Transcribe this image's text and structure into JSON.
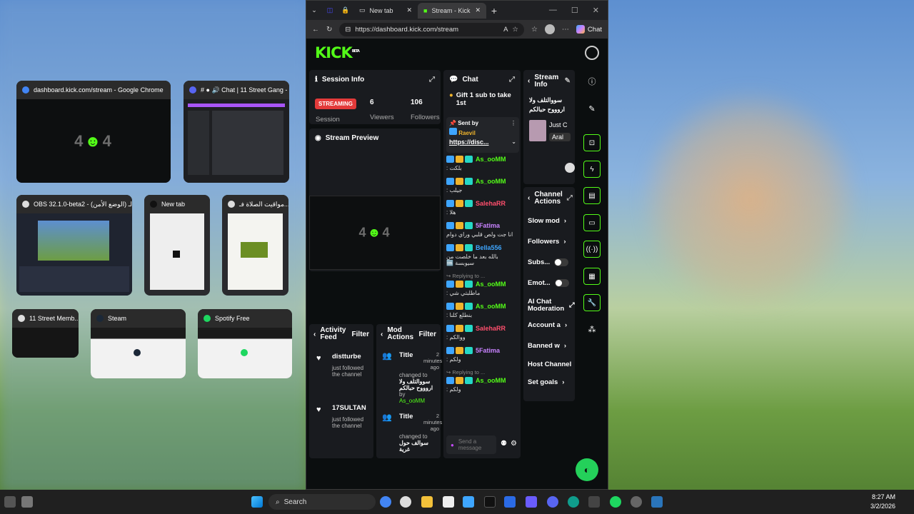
{
  "task_view": {
    "windows": [
      {
        "title": "dashboard.kick.com/stream - Google Chrome"
      },
      {
        "title": "# ● 🔊 Chat | 11 Street Gang - D..."
      },
      {
        "title": "OBS 32.1.0-beta2 - الـ (الوضع الأمن)"
      },
      {
        "title": "New tab"
      },
      {
        "title": "مواقيت الصلاة فـ..."
      },
      {
        "title": "11 Street Memb..."
      },
      {
        "title": "Steam"
      },
      {
        "title": "Spotify Free"
      }
    ],
    "error_text": "404"
  },
  "browser": {
    "tabs": [
      {
        "label": "New tab"
      },
      {
        "label": "Stream - Kick"
      }
    ],
    "url": "https://dashboard.kick.com/stream",
    "chat_button": "Chat"
  },
  "kick": {
    "logo": "KICK",
    "logo_sup": "BETA",
    "session": {
      "title": "Session Info",
      "status": "STREAMING",
      "status_label": "Session",
      "viewers_value": "6",
      "viewers_label": "Viewers",
      "followers_value": "106",
      "followers_label": "Followers"
    },
    "preview": {
      "title": "Stream Preview",
      "error_text": "404"
    },
    "chat": {
      "title": "Chat",
      "pinned": "Gift 1 sub to take 1st",
      "sent_by_label": "Sent by",
      "sent_by_user": "Raevil",
      "link": "https://disc...",
      "messages": [
        {
          "user": "As_ooMM",
          "color": "#53fc18",
          "text": "بلكت :",
          "reply": ""
        },
        {
          "user": "As_ooMM",
          "color": "#53fc18",
          "text": "جيلب :",
          "reply": ""
        },
        {
          "user": "SalehaRR",
          "color": "#ff4f6d",
          "text": "هلا :",
          "reply": ""
        },
        {
          "user": "5Fatima",
          "color": "#c882ff",
          "text": "انا جت ولص قلبي وراي دوام",
          "reply": ""
        },
        {
          "user": "Bella556",
          "color": "#3ea6ff",
          "text": "بالله بعد ما خلصت من سيوبسة 🆒",
          "reply": ""
        },
        {
          "user": "As_ooMM",
          "color": "#53fc18",
          "text": "ماطلبتي شي :",
          "reply": "Replying to ..."
        },
        {
          "user": "As_ooMM",
          "color": "#53fc18",
          "text": "بنطلع كلنا :",
          "reply": ""
        },
        {
          "user": "SalehaRR",
          "color": "#ff4f6d",
          "text": "ووالكم :",
          "reply": ""
        },
        {
          "user": "5Fatima",
          "color": "#c882ff",
          "text": "ولكم :",
          "reply": ""
        },
        {
          "user": "As_ooMM",
          "color": "#53fc18",
          "text": "ولكم :",
          "reply": "Replying to ..."
        }
      ],
      "input_placeholder": "Send a message"
    },
    "stream_info": {
      "title": "Stream Info",
      "stream_title": "سووالتلف ولا اروووح حبالكم",
      "category_line1": "Just C",
      "category_line2": "Aral"
    },
    "channel_actions": {
      "title": "Channel Actions",
      "items": [
        {
          "label": "Slow mod"
        },
        {
          "label": "Followers"
        },
        {
          "label": "Subs..."
        },
        {
          "label": "Emot..."
        },
        {
          "label": "AI Chat Moderation"
        },
        {
          "label": "Account a"
        },
        {
          "label": "Banned w"
        },
        {
          "label": "Host Channel"
        },
        {
          "label": "Set goals"
        }
      ]
    },
    "activity_feed": {
      "title": "Activity Feed",
      "filter": "Filter",
      "items": [
        {
          "name": "distturbe",
          "text": "just followed the channel"
        },
        {
          "name": "17SULTAN",
          "text": "just followed the channel"
        }
      ]
    },
    "mod_actions": {
      "title": "Mod Actions",
      "filter": "Filter",
      "items": [
        {
          "label": "Title",
          "time": "2 minutes ago",
          "text": "changed to",
          "value": "سووالتلف ولا اروووح حبالكم",
          "by": "by",
          "user": "As_ooMM"
        },
        {
          "label": "Title",
          "time": "2 minutes ago",
          "text": "changed to",
          "value": "سوالف حول غرية",
          "by": "",
          "user": ""
        }
      ]
    }
  },
  "taskbar": {
    "search": "Search",
    "time": "8:27 AM",
    "date": "3/2/2026"
  },
  "colors": {
    "kick_green": "#53fc18",
    "streaming_red": "#e33a3a"
  }
}
